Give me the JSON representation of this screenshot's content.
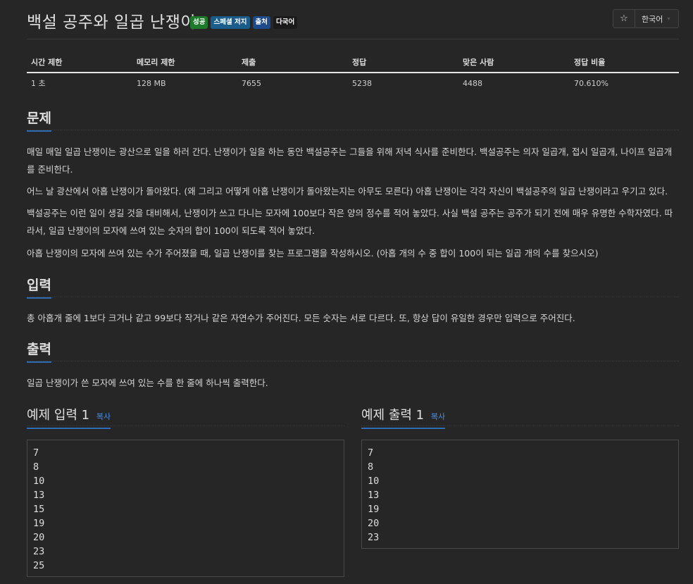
{
  "problem": {
    "title": "백설 공주와 일곱 난쟁이",
    "labels": [
      "성공",
      "스페셜 저지",
      "출처",
      "다국어"
    ],
    "star_icon": "☆",
    "language": "한국어"
  },
  "stats": {
    "headers": [
      "시간 제한",
      "메모리 제한",
      "제출",
      "정답",
      "맞은 사람",
      "정답 비율"
    ],
    "values": [
      "1 초",
      "128 MB",
      "7655",
      "5238",
      "4488",
      "70.610%"
    ]
  },
  "sections": {
    "problem_title": "문제",
    "problem_paragraphs": [
      "매일 매일 일곱 난쟁이는 광산으로 일을 하러 간다. 난쟁이가 일을 하는 동안 백설공주는 그들을 위해 저녁 식사를 준비한다. 백설공주는 의자 일곱개, 접시 일곱개, 나이프 일곱개를 준비한다.",
      "어느 날 광산에서 아홉 난쟁이가 돌아왔다. (왜 그리고 어떻게 아홉 난쟁이가 돌아왔는지는 아무도 모른다) 아홉 난쟁이는 각각 자신이 백설공주의 일곱 난쟁이라고 우기고 있다.",
      "백설공주는 이런 일이 생길 것을 대비해서, 난쟁이가 쓰고 다니는 모자에 100보다 작은 양의 정수를 적어 놓았다. 사실 백설 공주는 공주가 되기 전에 매우 유명한 수학자였다. 따라서, 일곱 난쟁이의 모자에 쓰여 있는 숫자의 합이 100이 되도록 적어 놓았다.",
      "아홉 난쟁이의 모자에 쓰여 있는 수가 주어졌을 때, 일곱 난쟁이를 찾는 프로그램을 작성하시오. (아홉 개의 수 중 합이 100이 되는 일곱 개의 수를 찾으시오)"
    ],
    "input_title": "입력",
    "input_text": "총 아홉개 줄에 1보다 크거나 같고 99보다 작거나 같은 자연수가 주어진다. 모든 숫자는 서로 다르다. 또, 항상 답이 유일한 경우만 입력으로 주어진다.",
    "output_title": "출력",
    "output_text": "일곱 난쟁이가 쓴 모자에 쓰여 있는 수를 한 줄에 하나씩 출력한다."
  },
  "samples": {
    "input_title": "예제 입력 1",
    "output_title": "예제 출력 1",
    "copy_label": "복사",
    "input_lines": [
      "7",
      "8",
      "10",
      "13",
      "15",
      "19",
      "20",
      "23",
      "25"
    ],
    "output_lines": [
      "7",
      "8",
      "10",
      "13",
      "19",
      "20",
      "23"
    ]
  }
}
